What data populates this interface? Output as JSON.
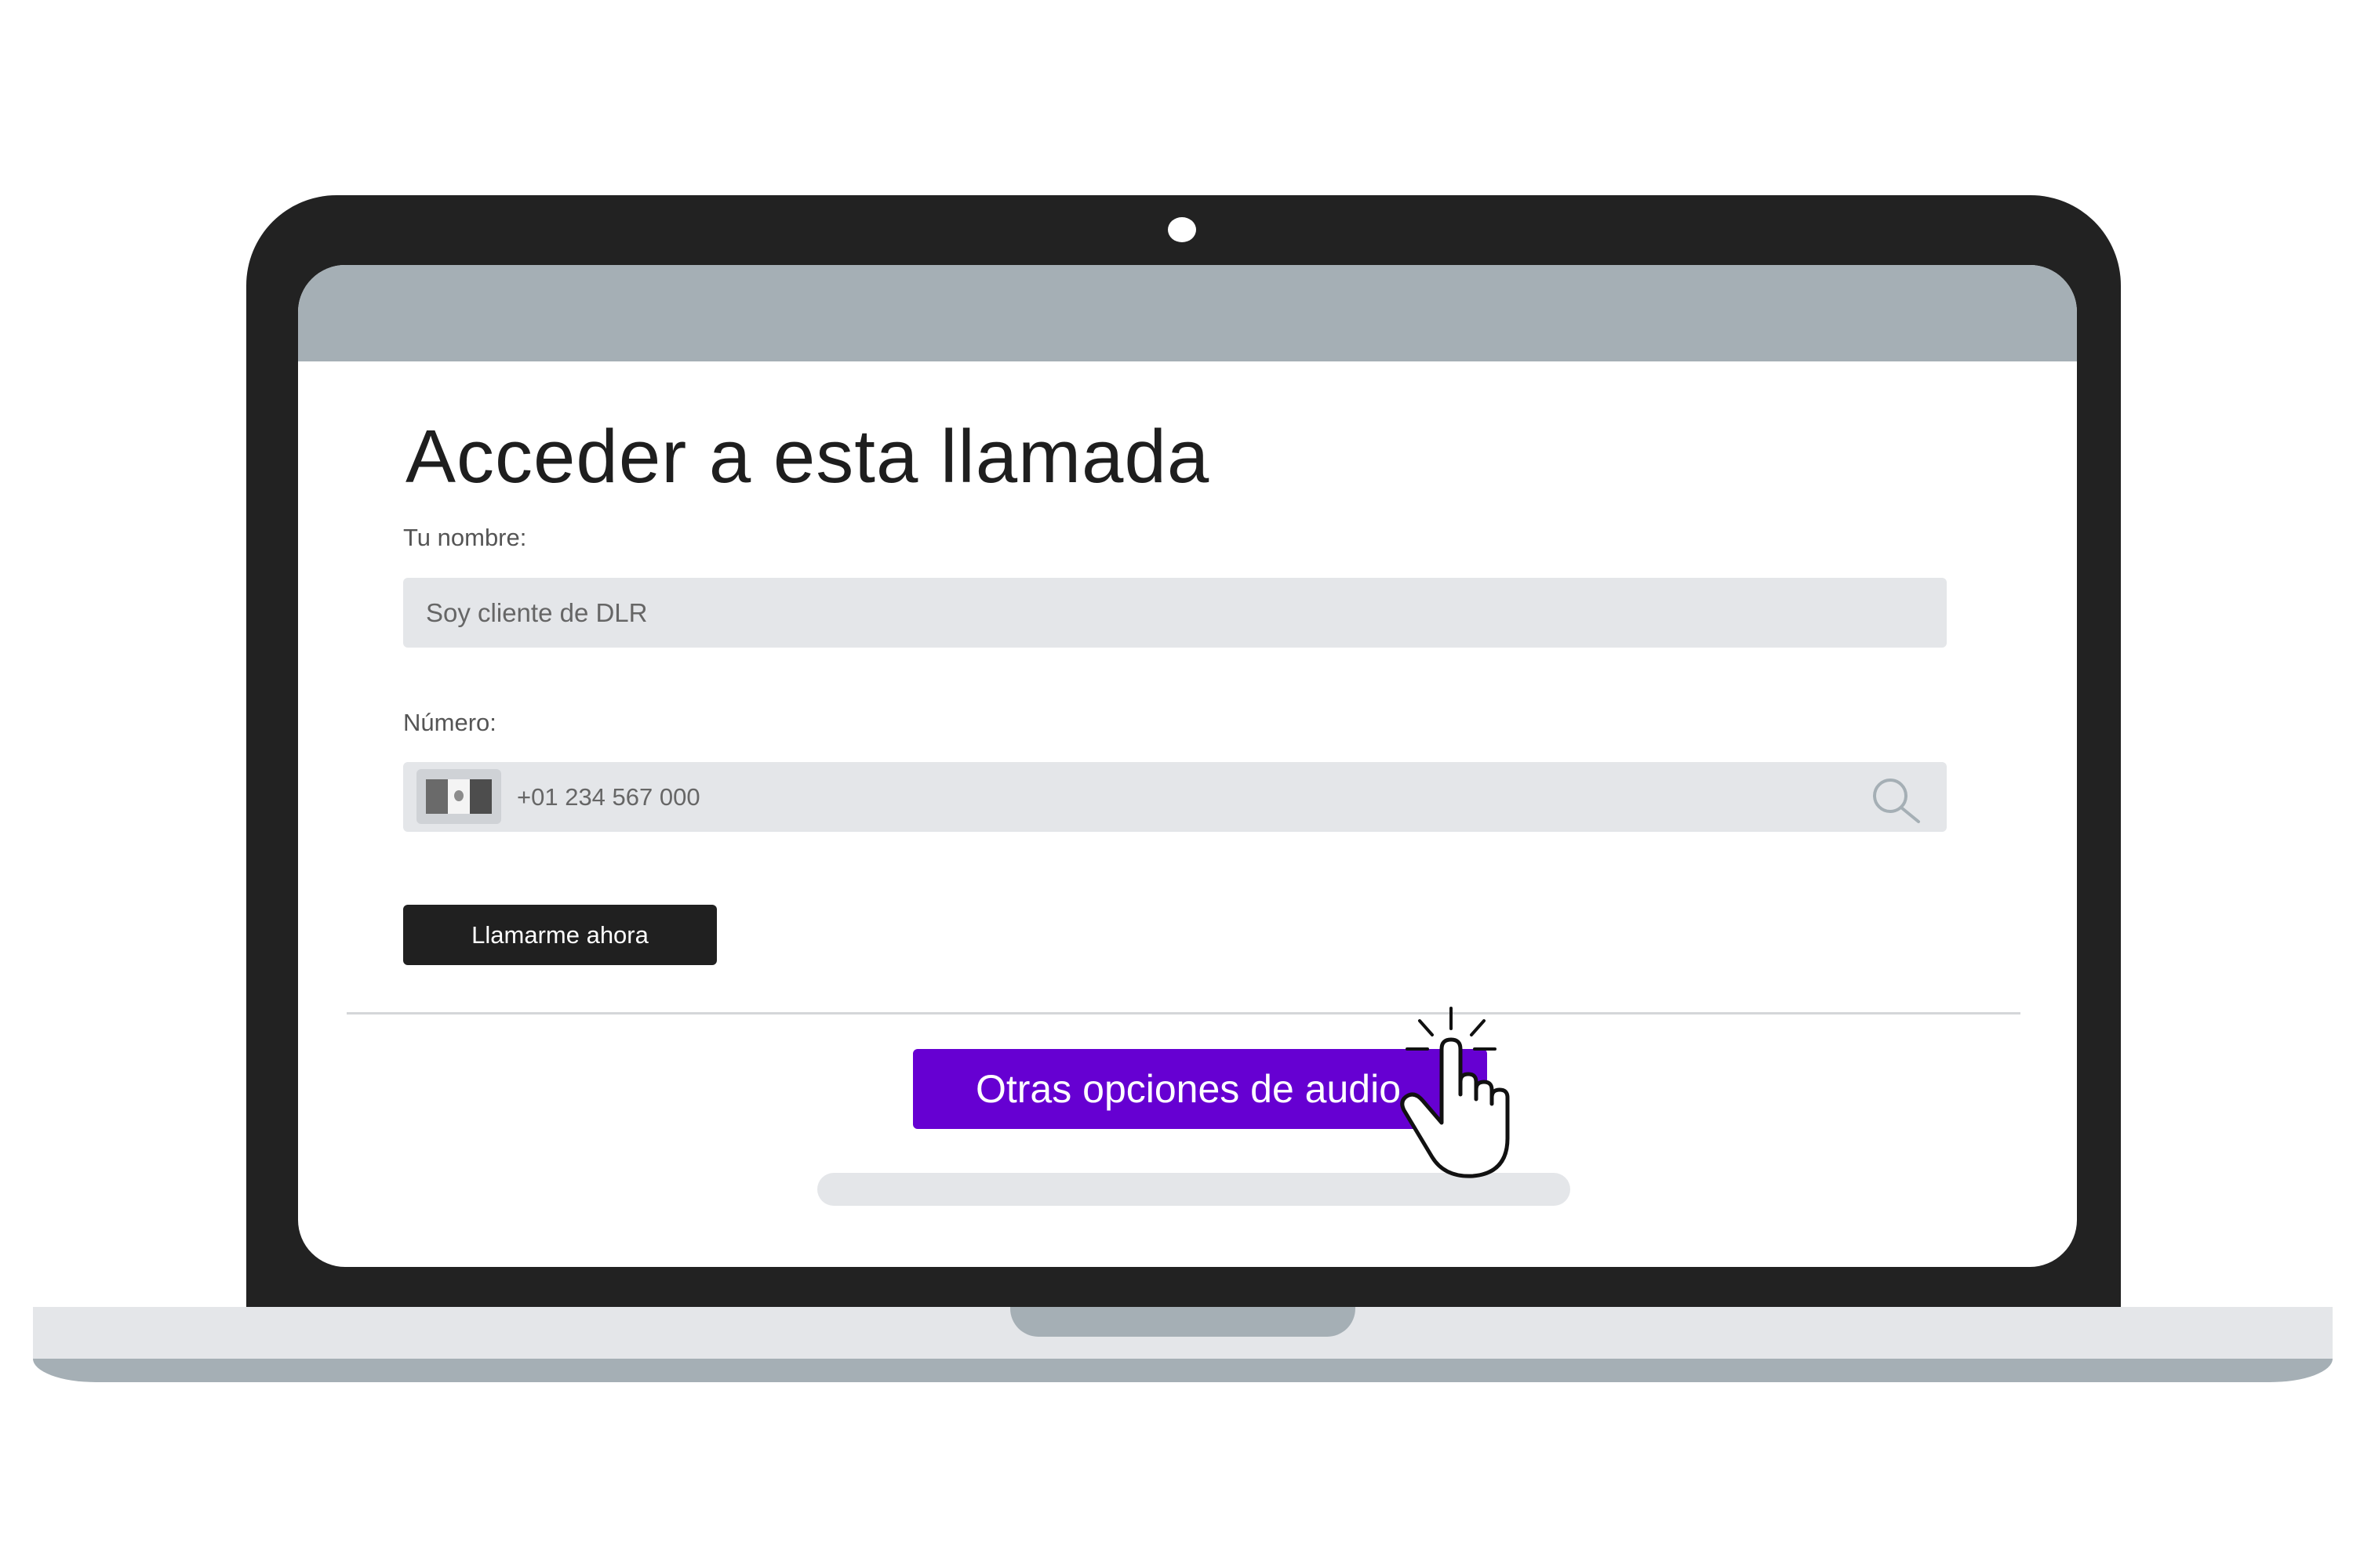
{
  "form": {
    "title": "Acceder a esta llamada",
    "name_label": "Tu nombre:",
    "name_value": "Soy cliente de DLR",
    "number_label": "Número:",
    "number_value": "+01 234 567 000",
    "call_button_label": "Llamarme ahora"
  },
  "audio": {
    "button_label": "Otras opciones de audio"
  },
  "colors": {
    "accent": "#6600d2",
    "dark": "#222222",
    "browser_bar": "#a5afb5",
    "input_bg": "#e4e6e9"
  }
}
